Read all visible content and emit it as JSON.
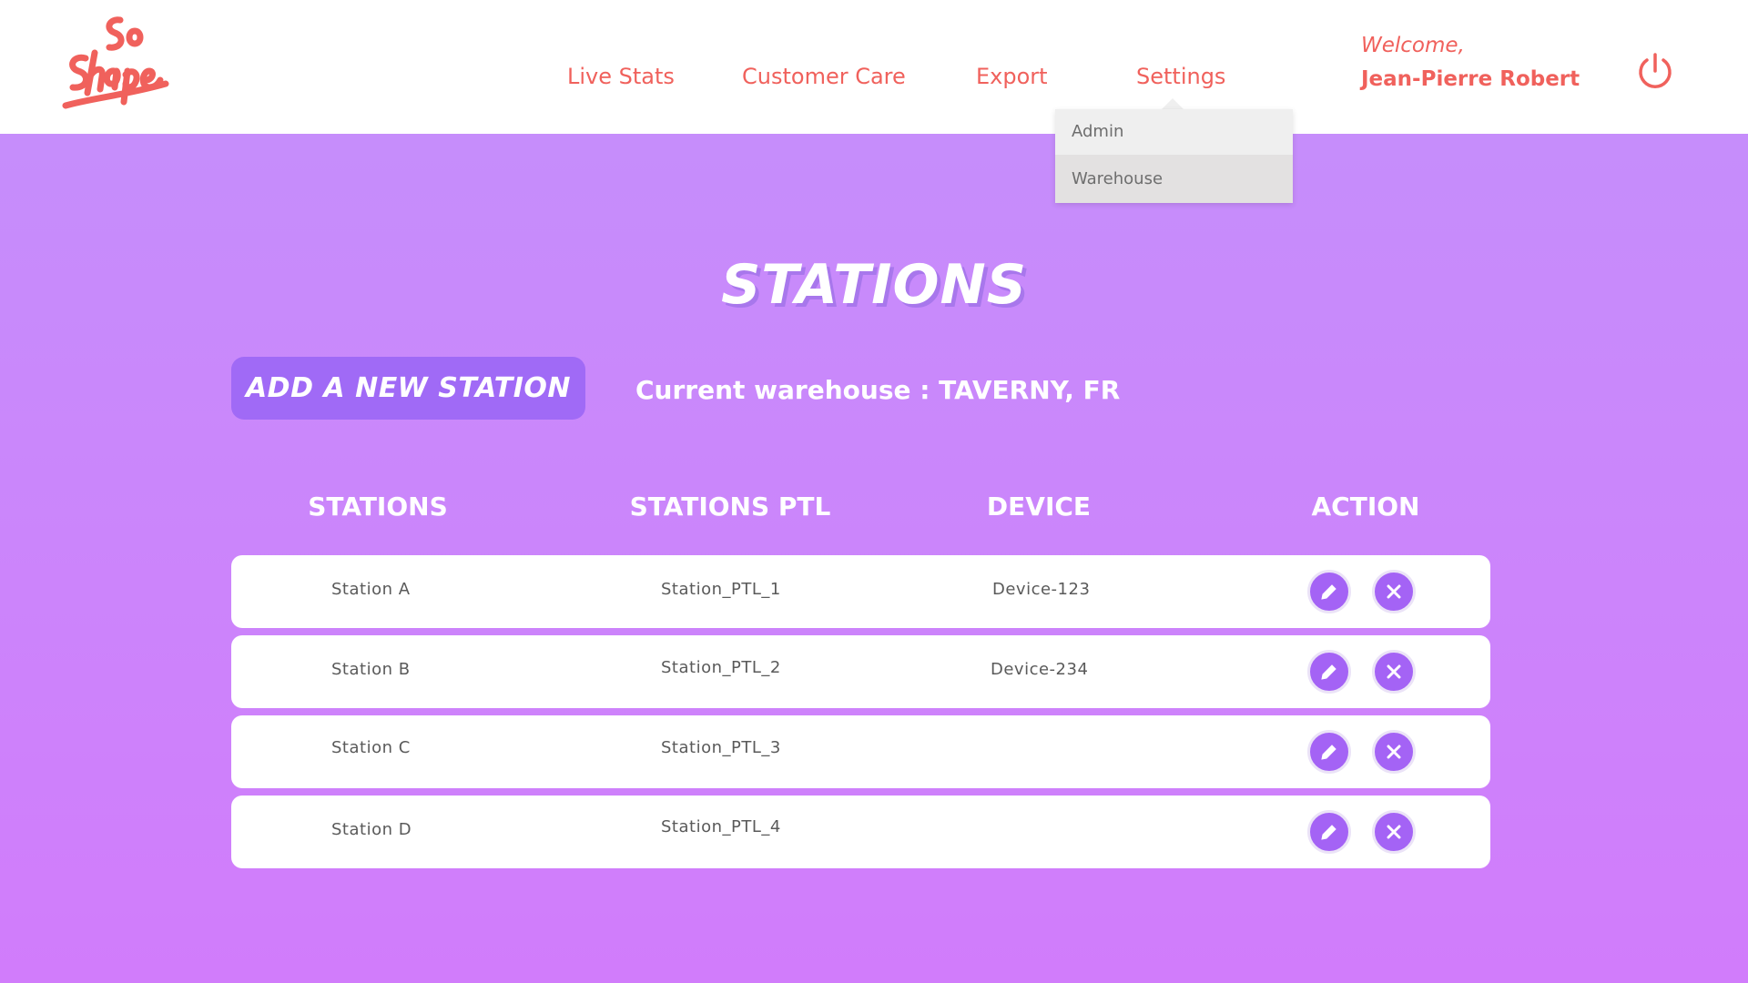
{
  "header": {
    "logo_text": "So Shape",
    "nav": [
      {
        "label": "Live Stats"
      },
      {
        "label": "Customer Care"
      },
      {
        "label": "Export"
      },
      {
        "label": "Settings"
      }
    ],
    "welcome_label": "Welcome,",
    "user_name": "Jean-Pierre Robert",
    "settings_dropdown": [
      {
        "label": "Admin",
        "active": false
      },
      {
        "label": "Warehouse",
        "active": true
      }
    ]
  },
  "main": {
    "title": "STATIONS",
    "add_button_label": "ADD A NEW STATION",
    "warehouse_text": "Current warehouse : TAVERNY, FR",
    "columns": [
      "STATIONS",
      "STATIONS PTL",
      "DEVICE",
      "ACTION"
    ],
    "rows": [
      {
        "station": "Station A",
        "station_ptl": "Station_PTL_1",
        "device": "Device-123"
      },
      {
        "station": "Station B",
        "station_ptl": "Station_PTL_2",
        "device": "Device-234"
      },
      {
        "station": "Station C",
        "station_ptl": "Station_PTL_3",
        "device": ""
      },
      {
        "station": "Station D",
        "station_ptl": "Station_PTL_4",
        "device": ""
      }
    ]
  },
  "colors": {
    "brand": "#f0615c",
    "accent": "#a06af6",
    "background_top": "#c490fb",
    "background_bottom": "#d17cfb"
  },
  "icons": [
    "power-icon",
    "edit-icon",
    "delete-icon",
    "logo"
  ]
}
